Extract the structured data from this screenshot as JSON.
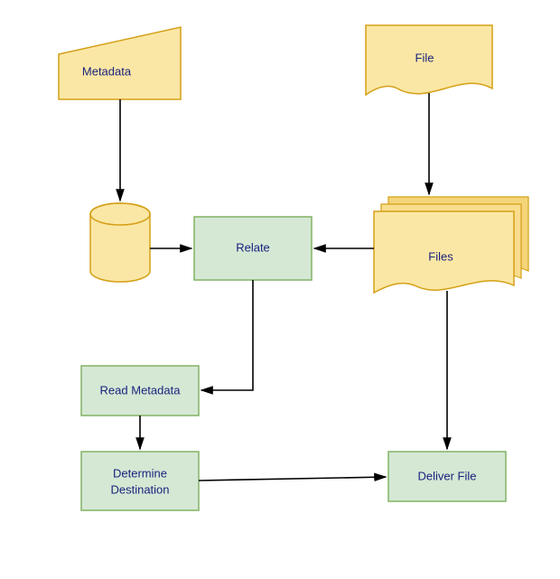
{
  "chart_data": {
    "type": "flowchart",
    "title": "",
    "nodes": [
      {
        "id": "metadata",
        "label": "Metadata",
        "shape": "manual-input",
        "category": "data"
      },
      {
        "id": "file",
        "label": "File",
        "shape": "document",
        "category": "data"
      },
      {
        "id": "db",
        "label": "",
        "shape": "database",
        "category": "data"
      },
      {
        "id": "relate",
        "label": "Relate",
        "shape": "process",
        "category": "process"
      },
      {
        "id": "files",
        "label": "Files",
        "shape": "multi-document",
        "category": "data"
      },
      {
        "id": "readmeta",
        "label": "Read Metadata",
        "shape": "process",
        "category": "process"
      },
      {
        "id": "determine",
        "label": "Determine Destination",
        "shape": "process",
        "category": "process"
      },
      {
        "id": "deliver",
        "label": "Deliver File",
        "shape": "process",
        "category": "process"
      }
    ],
    "edges": [
      {
        "from": "metadata",
        "to": "db"
      },
      {
        "from": "file",
        "to": "files"
      },
      {
        "from": "db",
        "to": "relate"
      },
      {
        "from": "files",
        "to": "relate"
      },
      {
        "from": "relate",
        "to": "readmeta"
      },
      {
        "from": "files",
        "to": "deliver"
      },
      {
        "from": "readmeta",
        "to": "determine"
      },
      {
        "from": "determine",
        "to": "deliver"
      }
    ]
  },
  "colors": {
    "data_fill": "#fbe7a5",
    "data_stroke": "#d4a017",
    "process_fill": "#d5e8d4",
    "process_stroke": "#82b366",
    "edge": "#000000",
    "label": "#1a237e"
  },
  "labels": {
    "metadata": "Metadata",
    "file": "File",
    "db": "",
    "relate": "Relate",
    "files": "Files",
    "readmeta": "Read Metadata",
    "determine_line1": "Determine",
    "determine_line2": "Destination",
    "deliver": "Deliver File"
  }
}
